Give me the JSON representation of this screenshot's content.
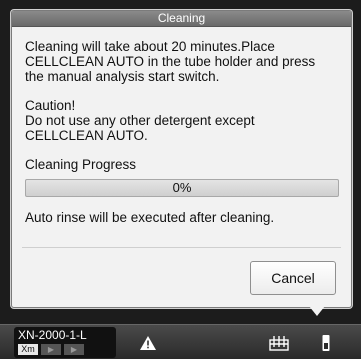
{
  "dialog": {
    "title": "Cleaning",
    "message": "Cleaning will take about 20 minutes.Place\nCELLCLEAN AUTO in the tube holder and press\nthe manual analysis start switch.",
    "caution_title": "Caution!",
    "caution_text": "Do not use any other detergent except\nCELLCLEAN AUTO.",
    "progress_label": "Cleaning Progress",
    "progress_value": 0,
    "progress_text": "0%",
    "auto_rinse_note": "Auto rinse will be executed after cleaning.",
    "cancel_label": "Cancel"
  },
  "taskbar": {
    "analyzer_name": "XN-2000-1-L",
    "mode_badge": "Xm",
    "icons": [
      "warning-icon",
      "rack-icon",
      "tube-icon"
    ]
  }
}
